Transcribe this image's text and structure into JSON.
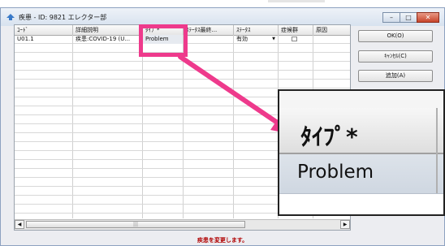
{
  "window": {
    "title": "疾患 - ID: 9821  エレクター部",
    "buttons": {
      "minimize": "–",
      "maximize": "□",
      "close": "✕"
    }
  },
  "grid": {
    "columns": [
      "ｺｰﾄﾞ",
      "詳細説明",
      "ﾀｲﾌﾟ*",
      "ｽﾃｰﾀｽ最終...",
      "ｽﾃｰﾀｽ",
      "症候群",
      "原因"
    ],
    "rows": [
      {
        "code": "U01.1",
        "description": "疾患:COVID-19 (U...",
        "type": "Problem",
        "status_last": "",
        "status": "有効",
        "syndrome": "",
        "cause": ""
      }
    ],
    "scroll_thumb": "|||"
  },
  "side_buttons": {
    "ok": "OK(O)",
    "cancel": "ｷｬﾝｾﾙ(C)",
    "add": "追加(A)"
  },
  "status_message": "疾患を変更します。",
  "zoom": {
    "header": "ﾀｲﾌﾟ*",
    "cell": "Problem"
  },
  "colors": {
    "highlight": "#ee3a8c",
    "status_text": "#b00000"
  }
}
